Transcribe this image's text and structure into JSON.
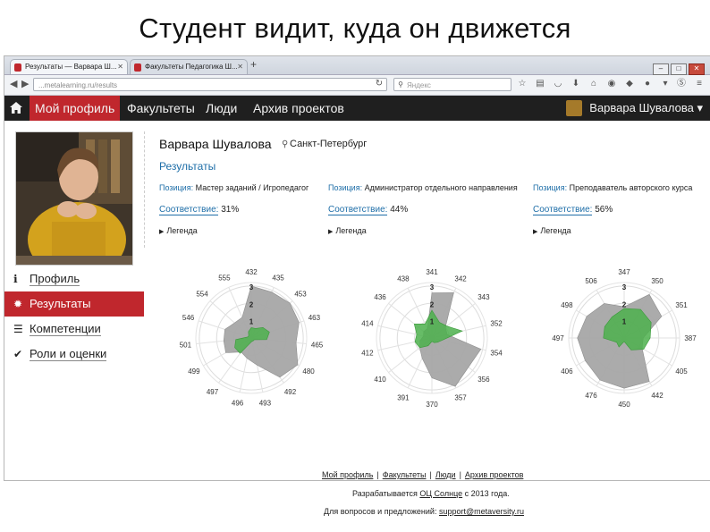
{
  "slide_title": "Студент видит, куда он движется",
  "browser": {
    "tabs": [
      {
        "label": "Результаты — Варвара Ш..."
      },
      {
        "label": "Факультеты Педагогика Ш..."
      }
    ],
    "url": "...metalearning.ru/results",
    "search_placeholder": "Яндекс"
  },
  "nav": {
    "items": [
      "Мой профиль",
      "Факультеты",
      "Люди",
      "Архив проектов"
    ],
    "user": "Варвара Шувалова"
  },
  "sidebar": {
    "items": [
      {
        "icon": "info-icon",
        "glyph": "ℹ",
        "label": "Профиль"
      },
      {
        "icon": "gear-icon",
        "glyph": "✹",
        "label": "Результаты"
      },
      {
        "icon": "list-icon",
        "glyph": "☰",
        "label": "Компетенции"
      },
      {
        "icon": "check-icon",
        "glyph": "✔",
        "label": "Роли и оценки"
      }
    ]
  },
  "profile": {
    "name": "Варвара Шувалова",
    "city": "Санкт-Петербург",
    "section_title": "Результаты"
  },
  "results": [
    {
      "position_label": "Позиция:",
      "position": "Мастер заданий / Игропедагог",
      "match_label": "Соответствие:",
      "match": "31%",
      "legend": "Легенда"
    },
    {
      "position_label": "Позиция:",
      "position": "Администратор отдельного направления",
      "match_label": "Соответствие:",
      "match": "44%",
      "legend": "Легенда"
    },
    {
      "position_label": "Позиция:",
      "position": "Преподаватель авторского курса",
      "match_label": "Соответствие:",
      "match": "56%",
      "legend": "Легенда"
    }
  ],
  "colors": {
    "accent": "#c0272d",
    "link": "#1e6ea8",
    "area_gray": "#a6a6a6",
    "area_green": "#4cb04c"
  },
  "chart_data": [
    {
      "type": "radar",
      "rings": [
        "1",
        "2",
        "3"
      ],
      "categories": [
        "432",
        "435",
        "453",
        "463",
        "465",
        "480",
        "492",
        "493",
        "496",
        "497",
        "499",
        "501",
        "546",
        "554",
        "555"
      ],
      "series": [
        {
          "values": [
            3,
            2.9,
            3,
            2.9,
            2.6,
            3.1,
            2.8,
            1.6,
            1.2,
            1,
            1.7,
            1.6,
            1.6,
            1.3,
            1.3
          ]
        },
        {
          "values": [
            0.6,
            0.6,
            0.9,
            1.1,
            0.9,
            0.2,
            0.2,
            0.2,
            0.3,
            1.1,
            1.1,
            0.9,
            0.2,
            0.2,
            0.4
          ]
        }
      ]
    },
    {
      "type": "radar",
      "rings": [
        "1",
        "2",
        "3"
      ],
      "categories": [
        "341",
        "342",
        "343",
        "352",
        "354",
        "356",
        "357",
        "370",
        "391",
        "410",
        "412",
        "414",
        "436",
        "438"
      ],
      "series": [
        {
          "values": [
            2.6,
            2.9,
            1,
            0.9,
            2.9,
            2.7,
            3.1,
            2.3,
            1.3,
            0.9,
            0.7,
            0.5,
            0.6,
            0.6
          ]
        },
        {
          "values": [
            1.6,
            1,
            1.1,
            1.8,
            0.6,
            0.4,
            0.3,
            0.2,
            0.5,
            0.9,
            1,
            0.9,
            1.3,
            0.9
          ]
        }
      ]
    },
    {
      "type": "radar",
      "rings": [
        "1",
        "2",
        "3"
      ],
      "categories": [
        "347",
        "350",
        "351",
        "387",
        "405",
        "442",
        "450",
        "476",
        "406",
        "497",
        "498",
        "506"
      ],
      "series": [
        {
          "values": [
            1.8,
            2.9,
            2.5,
            1.1,
            1.2,
            2.9,
            2.9,
            2.8,
            2.6,
            2.7,
            2.5,
            2.3
          ]
        },
        {
          "values": [
            1.7,
            1.9,
            1.8,
            1.5,
            1.3,
            0.8,
            0.2,
            0.6,
            0.5,
            1.2,
            1.3,
            1.4
          ]
        }
      ]
    }
  ],
  "footer": {
    "links": [
      "Мой профиль",
      "Факультеты",
      "Люди",
      "Архив проектов"
    ],
    "dev_prefix": "Разрабатывается ",
    "dev_link": "ОЦ Солнце",
    "dev_suffix": " с 2013 года.",
    "contact_prefix": "Для вопросов и предложений: ",
    "contact_email": "support@metaversity.ru"
  }
}
